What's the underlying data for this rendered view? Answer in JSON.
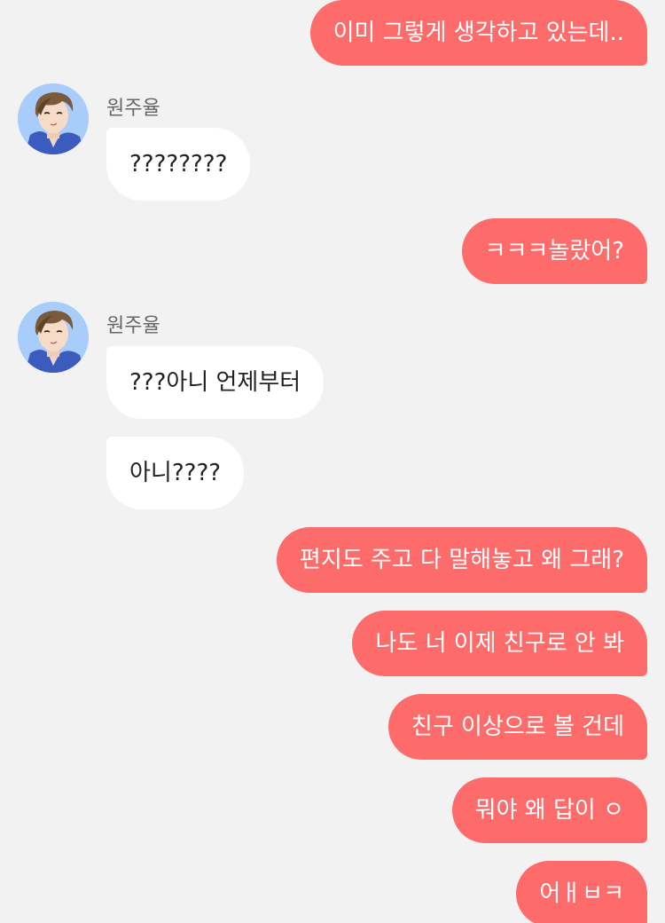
{
  "sender": {
    "name": "원주율"
  },
  "messages": {
    "m1": "이미 그렇게 생각하고 있는데..",
    "m2": "????????",
    "m3": "ㅋㅋㅋ놀랐어?",
    "m4": "???아니 언제부터",
    "m5": "아니????",
    "m6": "편지도 주고 다 말해놓고 왜 그래?",
    "m7": "나도 너 이제 친구로 안 봐",
    "m8": "친구 이상으로 볼 건데",
    "m9": "뭐야 왜 답이 ㅇ",
    "m10": "어ㅐㅂㅋ"
  },
  "colors": {
    "background": "#f2f2f2",
    "outgoing_bubble": "#fe6b6b",
    "incoming_bubble": "#ffffff"
  },
  "icons": {
    "avatar": "avatar-icon"
  }
}
